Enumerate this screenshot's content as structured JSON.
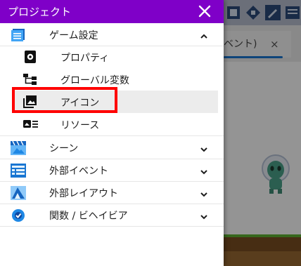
{
  "drawer": {
    "title": "プロジェクト",
    "close_icon": "close-icon",
    "accent_color": "#7f00c8"
  },
  "game_settings": {
    "label": "ゲーム設定",
    "icon": "settings-list-icon",
    "expanded": true,
    "items": [
      {
        "label": "プロパティ",
        "icon": "gear-icon"
      },
      {
        "label": "グローバル変数",
        "icon": "variables-tree-icon"
      },
      {
        "label": "アイコン",
        "icon": "image-stack-icon",
        "selected": true
      },
      {
        "label": "リソース",
        "icon": "resources-icon"
      }
    ]
  },
  "sections": [
    {
      "label": "シーン",
      "icon": "scene-clapper-icon"
    },
    {
      "label": "外部イベント",
      "icon": "external-events-icon"
    },
    {
      "label": "外部レイアウト",
      "icon": "external-layout-icon"
    },
    {
      "label": "関数 / ビヘイビア",
      "icon": "extension-gear-icon"
    }
  ],
  "background": {
    "tab_label": "ベント)",
    "tab_close": "×"
  },
  "highlight_color": "#ff0000"
}
